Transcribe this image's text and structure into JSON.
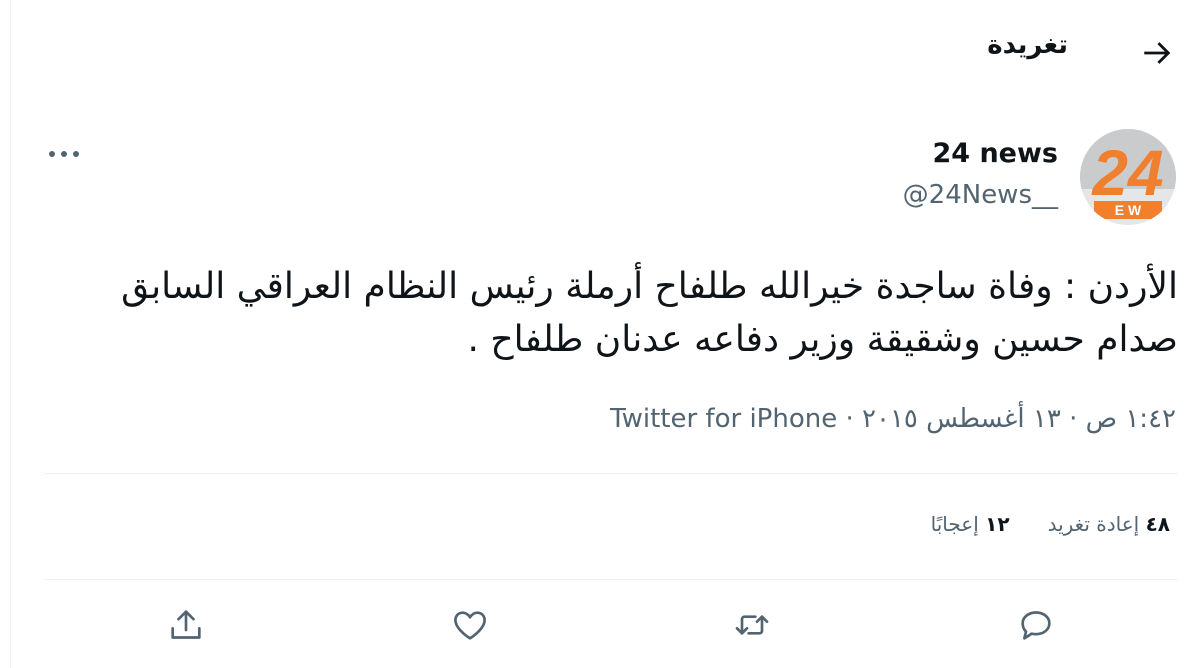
{
  "header": {
    "title": "تغريدة"
  },
  "author": {
    "display_name": "24 news",
    "handle": "@24News__",
    "avatar_text": "24",
    "avatar_sub": "E W"
  },
  "tweet": {
    "text": "الأردن : وفاة ساجدة خيرالله طلفاح أرملة رئيس النظام العراقي السابق صدام حسين وشقيقة وزير دفاعه عدنان طلفاح .",
    "time": "١:٤٢ ص",
    "date": "١٣ أغسطس ٢٠١٥",
    "separator": " · ",
    "source": "Twitter for iPhone"
  },
  "stats": {
    "retweets_count": "٤٨",
    "retweets_label": "إعادة تغريد",
    "likes_count": "١٢",
    "likes_label": "إعجابًا"
  },
  "colors": {
    "accent": "#1d9bf0",
    "brand_orange": "#f07f2e",
    "muted": "#536471"
  }
}
